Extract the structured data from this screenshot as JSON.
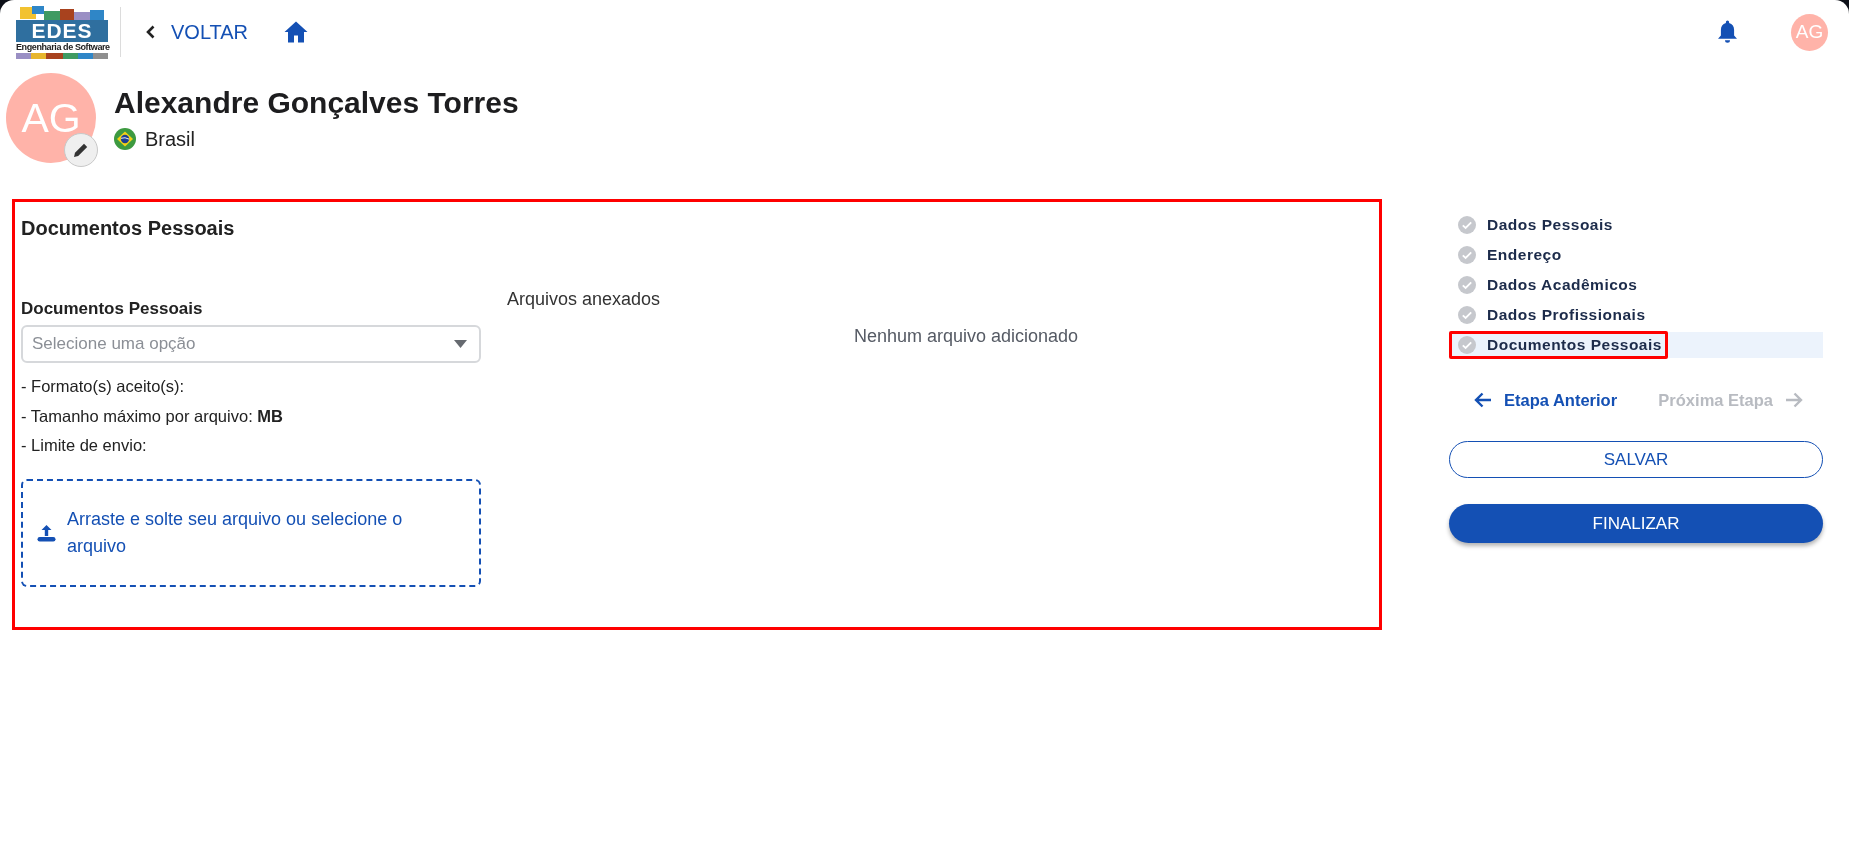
{
  "header": {
    "logo": {
      "wordmark": "EDES",
      "tagline": "Engenharia de Software"
    },
    "back_link": {
      "label": "VOLTAR"
    },
    "avatar": {
      "initials": "AG"
    }
  },
  "profile": {
    "initials": "AG",
    "name": "Alexandre Gonçalves Torres",
    "country": "Brasil"
  },
  "section": {
    "title": "Documentos Pessoais",
    "highlighted": true,
    "document_field": {
      "label": "Documentos Pessoais",
      "placeholder": "Selecione uma opção"
    },
    "requirements": [
      "- Formato(s) aceito(s):",
      "- Tamanho máximo por arquivo: **MB**",
      "- Limite de envio:"
    ],
    "dropzone": {
      "text": "Arraste e solte seu arquivo ou selecione o arquivo"
    },
    "attachments": {
      "title": "Arquivos anexados",
      "empty_message": "Nenhum arquivo adicionado"
    }
  },
  "steps": [
    {
      "label": "Dados Pessoais",
      "selected": false,
      "highlighted": false
    },
    {
      "label": "Endereço",
      "selected": false,
      "highlighted": false
    },
    {
      "label": "Dados Acadêmicos",
      "selected": false,
      "highlighted": false
    },
    {
      "label": "Dados Profissionais",
      "selected": false,
      "highlighted": false
    },
    {
      "label": "Documentos Pessoais",
      "selected": true,
      "highlighted": true
    }
  ],
  "step_nav": [
    {
      "kind": "previous",
      "label": "Etapa Anterior",
      "disabled": false
    },
    {
      "kind": "next",
      "label": "Próxima Etapa",
      "disabled": true
    }
  ],
  "actions": [
    {
      "kind": "outline",
      "label": "SALVAR"
    },
    {
      "kind": "filled",
      "label": "FINALIZAR"
    }
  ]
}
